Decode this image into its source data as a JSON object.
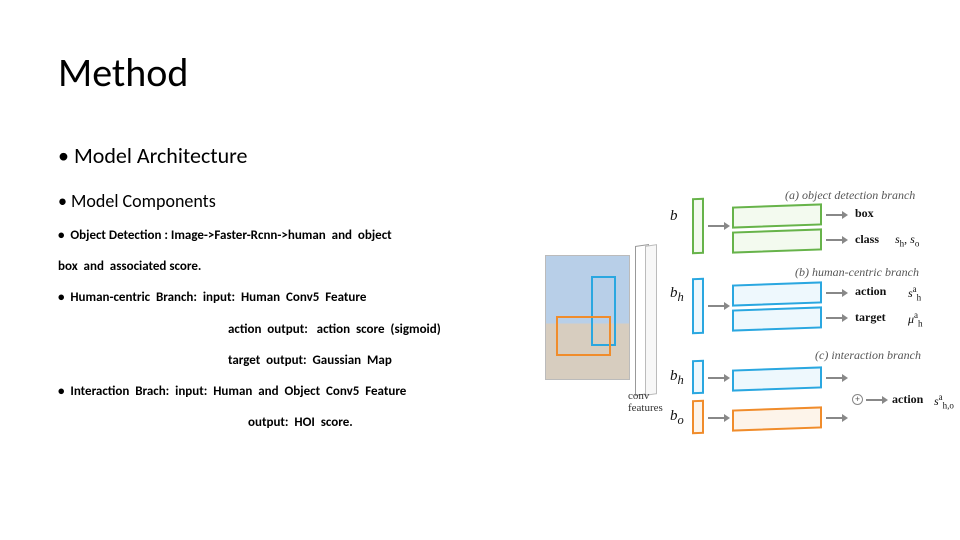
{
  "title": "Method",
  "bullets": {
    "arch": "Model Architecture",
    "comps": "Model Components"
  },
  "lines": {
    "l1": "•  Object Detection : Image->Faster-Rcnn->human  and  object",
    "l2": "box  and  associated score.",
    "l3": "•  Human-centric  Branch:  input:  Human  Conv5  Feature",
    "l4": "action  output:   action  score  (sigmoid)",
    "l5": "target  output:  Gaussian  Map",
    "l6": "•  Interaction  Brach:  input:  Human  and  Object  Conv5  Feature",
    "l7": "output:  HOI  score."
  },
  "diagram": {
    "conv_features": "conv\nfeatures",
    "b": "b",
    "bh": "b",
    "bh_sub": "h",
    "bo": "b",
    "bo_sub": "o",
    "branch_a": "(a) object detection branch",
    "branch_b": "(b) human-centric branch",
    "branch_c": "(c) interaction branch",
    "box": "box",
    "class": "class",
    "action": "action",
    "target": "target",
    "s_h": "s",
    "s_h_sub": "h",
    "s_o": "s",
    "s_o_sub": "o",
    "s_a_h": "s",
    "mu_a_h": "μ",
    "s_a_ho": "s",
    "sup_a": "a",
    "sub_ho": "h,o"
  }
}
